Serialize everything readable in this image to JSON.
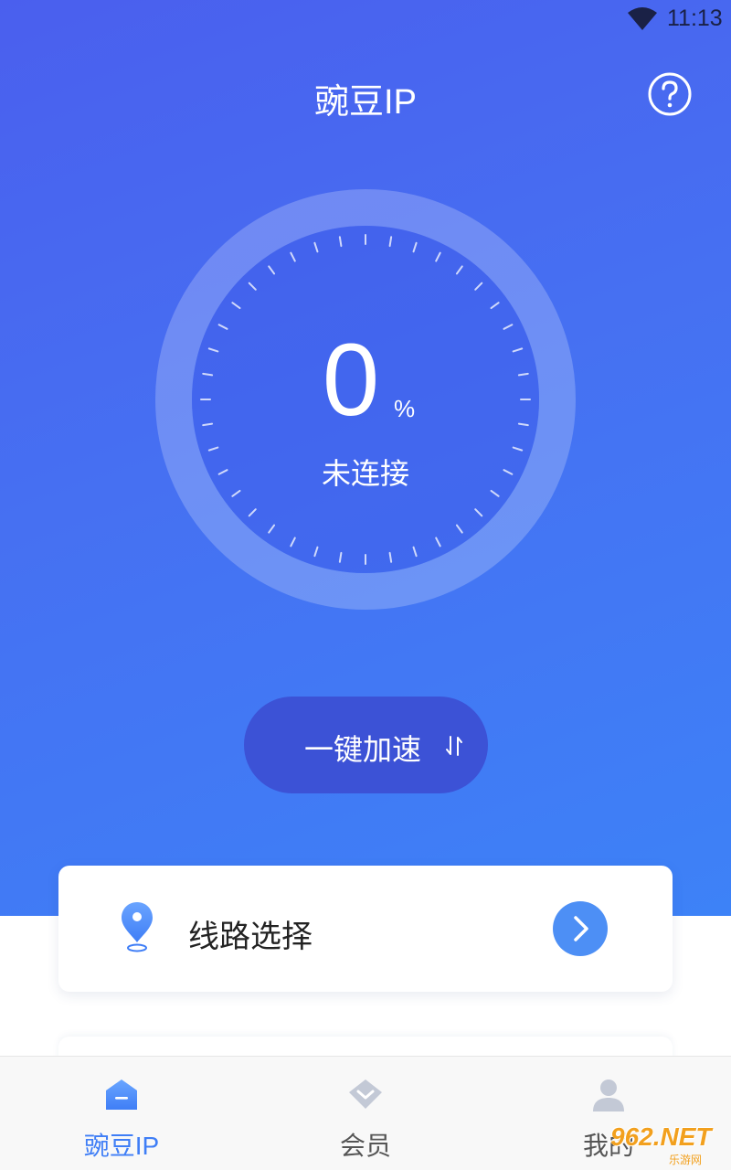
{
  "status_bar": {
    "time": "11:13"
  },
  "header": {
    "title": "豌豆IP"
  },
  "gauge": {
    "percent_value": "0",
    "percent_unit": "%",
    "status": "未连接",
    "progress": 0
  },
  "boost_button": {
    "label": "一键加速"
  },
  "route_card": {
    "label": "线路选择"
  },
  "bottom_nav": {
    "items": [
      {
        "label": "豌豆IP",
        "active": true
      },
      {
        "label": "会员",
        "active": false
      },
      {
        "label": "我的",
        "active": false
      }
    ]
  },
  "watermark": {
    "main": "962.NET",
    "sub": "乐游网"
  },
  "colors": {
    "accent": "#3f7ef6",
    "hero_start": "#4a5fee",
    "hero_end": "#3d82f7",
    "boost_button": "#3c52d6",
    "inactive_icon": "#c3c9d6"
  },
  "icons": [
    "wifi-icon",
    "help-icon",
    "boost-arrows-icon",
    "location-pin-icon",
    "chevron-right-icon",
    "home-icon",
    "diamond-icon",
    "user-icon"
  ]
}
